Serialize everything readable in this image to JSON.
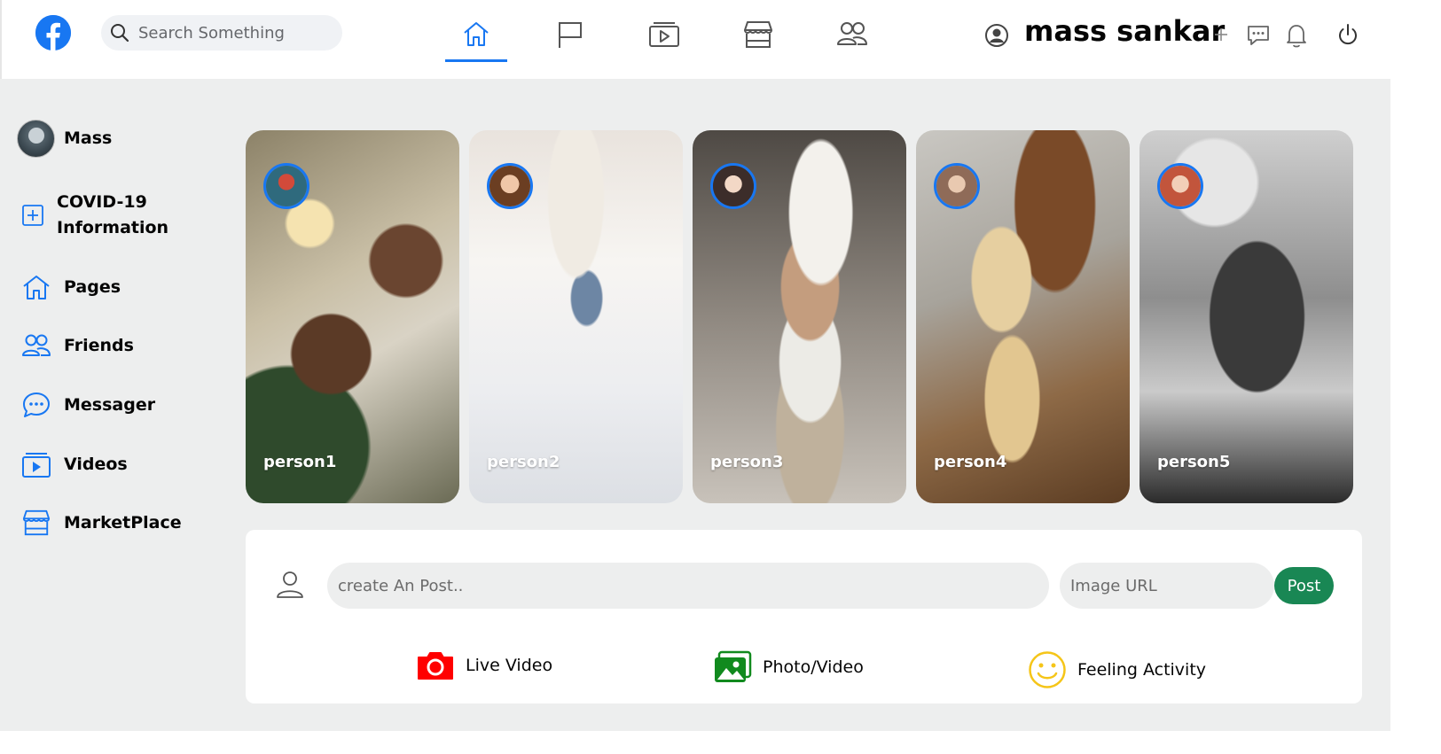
{
  "header": {
    "search_placeholder": "Search Something",
    "user_name": "mass sankar",
    "nav_tabs": [
      "home",
      "pages",
      "watch",
      "marketplace",
      "groups"
    ]
  },
  "sidebar": {
    "profile_name": "Mass",
    "items": [
      {
        "label": "COVID-19 Information",
        "icon": "plus-square-icon"
      },
      {
        "label": "Pages",
        "icon": "home-icon"
      },
      {
        "label": "Friends",
        "icon": "friends-icon"
      },
      {
        "label": "Messager",
        "icon": "message-icon"
      },
      {
        "label": "Videos",
        "icon": "video-icon"
      },
      {
        "label": "MarketPlace",
        "icon": "store-icon"
      }
    ]
  },
  "stories": [
    {
      "name": "person1"
    },
    {
      "name": "person2"
    },
    {
      "name": "person3"
    },
    {
      "name": "person4"
    },
    {
      "name": "person5"
    }
  ],
  "composer": {
    "post_placeholder": "create An Post..",
    "url_placeholder": "Image URL",
    "post_button": "Post",
    "actions": [
      {
        "label": "Live Video",
        "icon": "camera-icon",
        "color": "#ff0000"
      },
      {
        "label": "Photo/Video",
        "icon": "photo-icon",
        "color": "#118a1e"
      },
      {
        "label": "Feeling Activity",
        "icon": "smile-icon",
        "color": "#f5c518"
      }
    ]
  },
  "colors": {
    "accent": "#1877f2",
    "post_button": "#198754",
    "page_bg": "#edeeee"
  }
}
